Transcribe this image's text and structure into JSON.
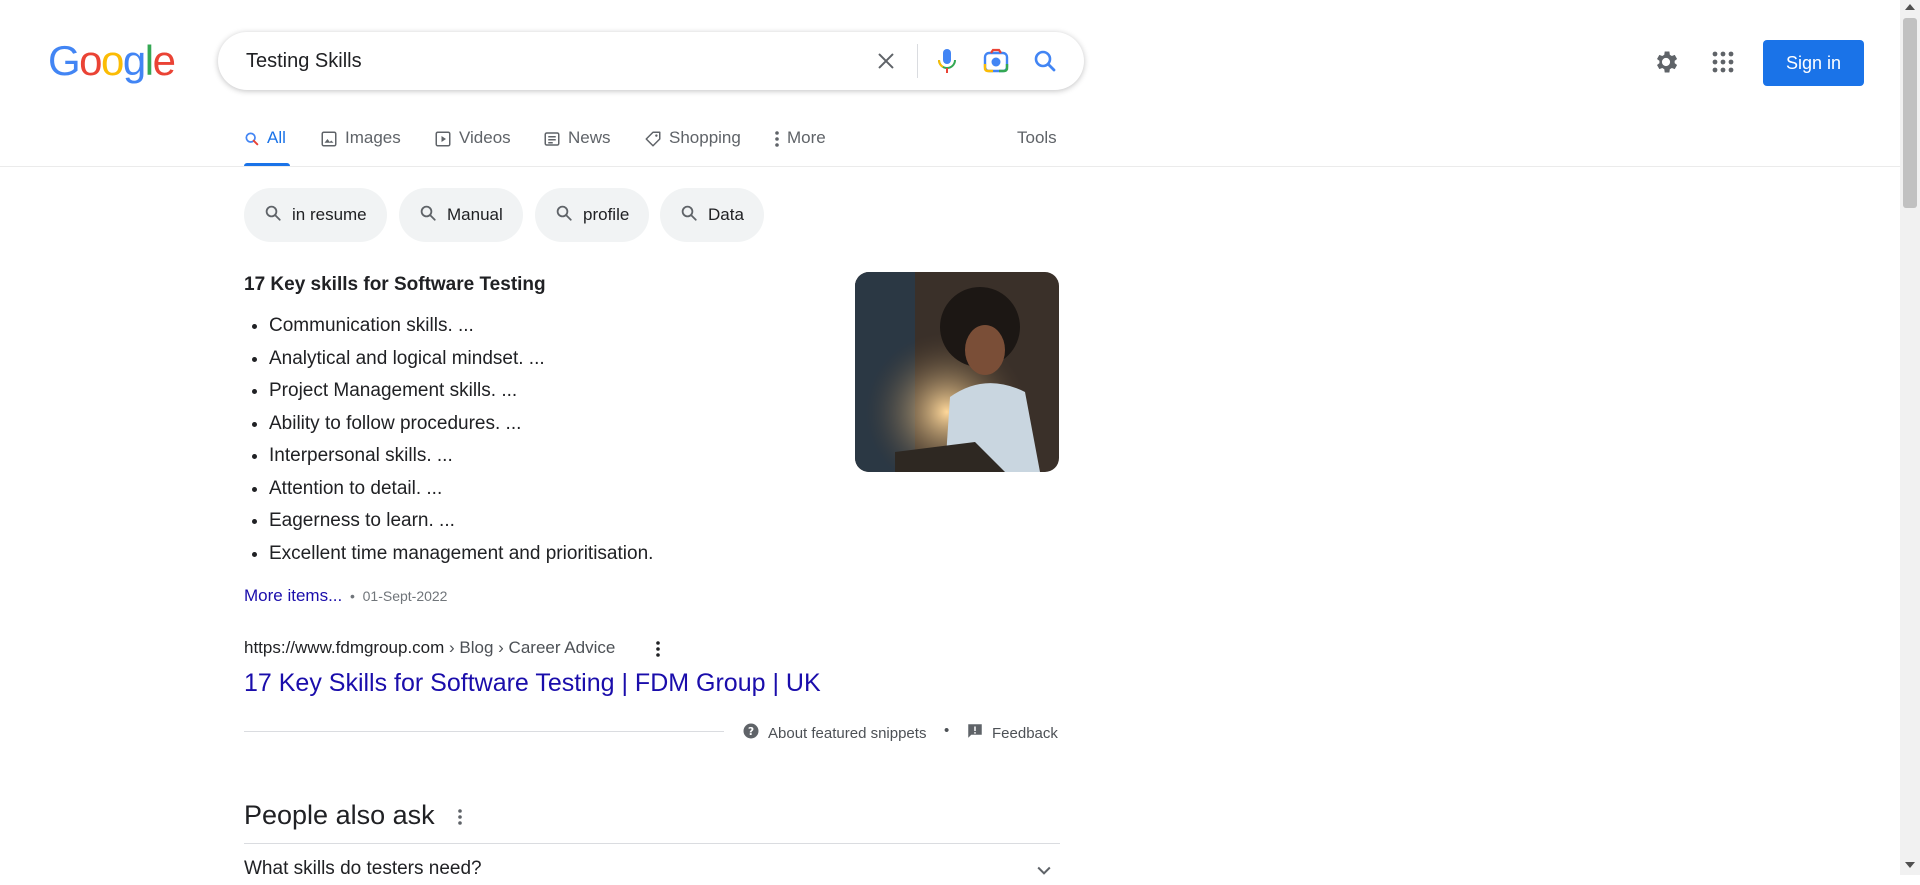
{
  "header": {
    "logo_letters": [
      "G",
      "o",
      "o",
      "g",
      "l",
      "e"
    ],
    "logo_colors": [
      "#4285F4",
      "#EA4335",
      "#FBBC05",
      "#4285F4",
      "#34A853",
      "#EA4335"
    ],
    "search": {
      "value": "Testing Skills"
    },
    "signin_label": "Sign in",
    "icons": [
      "clear-icon",
      "microphone-icon",
      "camera-lens-icon",
      "search-icon",
      "gear-icon",
      "apps-grid-icon"
    ]
  },
  "tabs": [
    {
      "label": "All",
      "icon": "search-icon",
      "active": true
    },
    {
      "label": "Images",
      "icon": "image-icon"
    },
    {
      "label": "Videos",
      "icon": "play-icon"
    },
    {
      "label": "News",
      "icon": "newspaper-icon"
    },
    {
      "label": "Shopping",
      "icon": "tag-icon"
    },
    {
      "label": "More",
      "icon": "kebab-icon"
    }
  ],
  "tools_label": "Tools",
  "chips": [
    "in resume",
    "Manual",
    "profile",
    "Data"
  ],
  "snippet": {
    "title": "17 Key skills for Software Testing",
    "items": [
      "Communication skills. ...",
      "Analytical and logical mindset. ...",
      "Project Management skills. ...",
      "Ability to follow procedures. ...",
      "Interpersonal skills. ...",
      "Attention to detail. ...",
      "Eagerness to learn. ...",
      "Excellent time management and prioritisation."
    ],
    "more_items": "More items...",
    "separator": "•",
    "date": "01-Sept-2022",
    "cite_domain": "https://www.fdmgroup.com",
    "cite_crumbs": " › Blog › Career Advice",
    "result_title": "17 Key Skills for Software Testing | FDM Group | UK",
    "about_label": "About featured snippets",
    "feedback_label": "Feedback"
  },
  "people_also_ask": {
    "title": "People also ask",
    "first_question": "What skills do testers need?"
  },
  "colors": {
    "accent": "#1a73e8",
    "link": "#1a0dab",
    "chip_bg": "#f1f3f4"
  }
}
